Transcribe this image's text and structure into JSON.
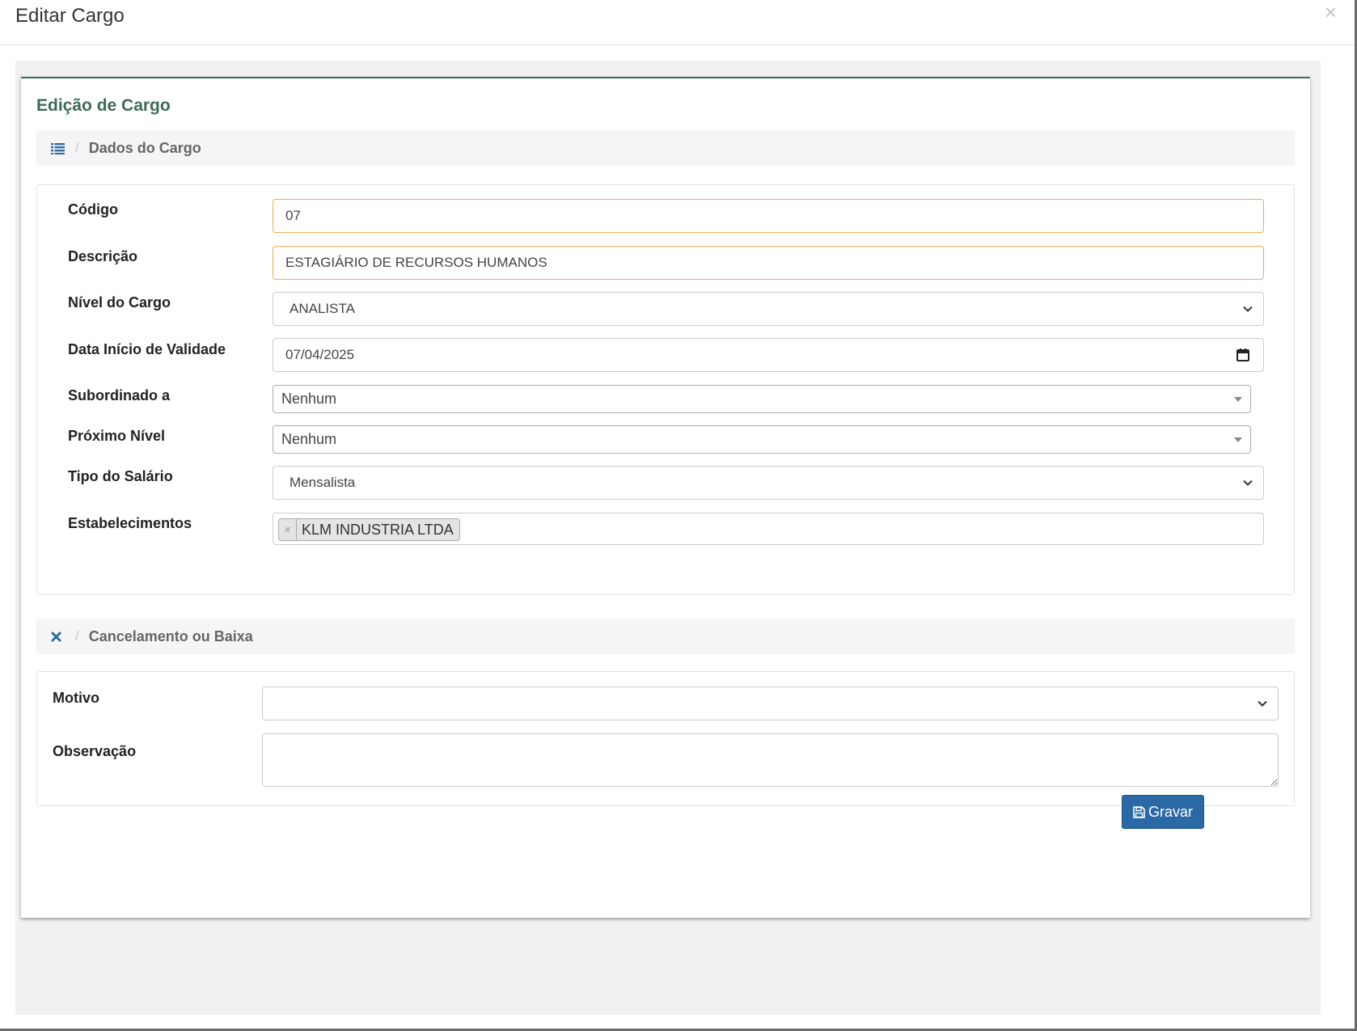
{
  "modal": {
    "title": "Editar Cargo",
    "close_symbol": "×"
  },
  "box": {
    "title": "Edição de Cargo"
  },
  "section_cargo": {
    "icon": "list-icon",
    "separator": "/",
    "label": "Dados do Cargo"
  },
  "fields": {
    "codigo": {
      "label": "Código",
      "value": "07"
    },
    "descricao": {
      "label": "Descrição",
      "value": "ESTAGIÁRIO DE RECURSOS HUMANOS"
    },
    "nivel": {
      "label": "Nível do Cargo",
      "value": "ANALISTA"
    },
    "data_inicio": {
      "label": "Data Início de Validade",
      "value": "07/04/2025"
    },
    "subordinado": {
      "label": "Subordinado a",
      "value": "Nenhum"
    },
    "proximo_nivel": {
      "label": "Próximo Nível",
      "value": "Nenhum"
    },
    "tipo_salario": {
      "label": "Tipo do Salário",
      "value": "Mensalista"
    },
    "estabelecimentos": {
      "label": "Estabelecimentos",
      "tag": "KLM INDUSTRIA LTDA",
      "tag_remove": "×"
    }
  },
  "section_cancel": {
    "icon": "close-icon",
    "separator": "/",
    "label": "Cancelamento ou Baixa"
  },
  "cancel_fields": {
    "motivo": {
      "label": "Motivo",
      "value": ""
    },
    "observacao": {
      "label": "Observação",
      "value": ""
    }
  },
  "actions": {
    "save_label": "Gravar"
  },
  "colors": {
    "accent_green": "#3d6b55",
    "primary_blue": "#2a69a5",
    "focus_orange": "#f0ad4e"
  }
}
